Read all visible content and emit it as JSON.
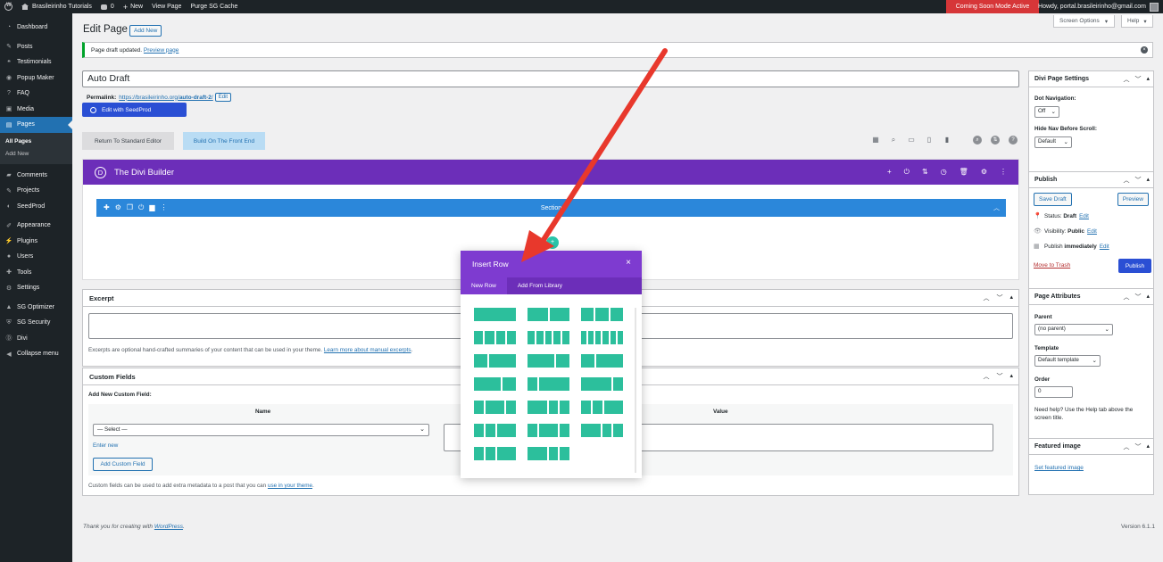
{
  "adminbar": {
    "site_name": "Brasileirinho Tutorials",
    "comments_count": "0",
    "new_label": "New",
    "view_page": "View Page",
    "purge": "Purge SG Cache",
    "coming_soon": "Coming Soon Mode Active",
    "howdy": "Howdy, portal.brasileirinho@gmail.com"
  },
  "sidebar": {
    "items": [
      {
        "label": "Dashboard",
        "icon": "dashboard-icon"
      },
      {
        "label": "Posts",
        "icon": "pin-icon"
      },
      {
        "label": "Testimonials",
        "icon": "testimonial-icon"
      },
      {
        "label": "Popup Maker",
        "icon": "popup-icon"
      },
      {
        "label": "FAQ",
        "icon": "question-icon"
      },
      {
        "label": "Media",
        "icon": "media-icon"
      },
      {
        "label": "Pages",
        "icon": "page-icon"
      },
      {
        "label": "Comments",
        "icon": "comment-icon"
      },
      {
        "label": "Projects",
        "icon": "project-icon"
      },
      {
        "label": "SeedProd",
        "icon": "seedprod-icon"
      },
      {
        "label": "Appearance",
        "icon": "brush-icon"
      },
      {
        "label": "Plugins",
        "icon": "plugin-icon"
      },
      {
        "label": "Users",
        "icon": "user-icon"
      },
      {
        "label": "Tools",
        "icon": "wrench-icon"
      },
      {
        "label": "Settings",
        "icon": "gear-icon"
      },
      {
        "label": "SG Optimizer",
        "icon": "optimizer-icon"
      },
      {
        "label": "SG Security",
        "icon": "shield-icon"
      },
      {
        "label": "Divi",
        "icon": "divi-icon"
      },
      {
        "label": "Collapse menu",
        "icon": "collapse-icon"
      }
    ],
    "submenu": [
      "All Pages",
      "Add New"
    ]
  },
  "header": {
    "title": "Edit Page",
    "add_new": "Add New",
    "screen_options": "Screen Options",
    "help": "Help"
  },
  "notice": {
    "text": "Page draft updated.",
    "link": "Preview page"
  },
  "editor": {
    "post_title": "Auto Draft",
    "permalink_label": "Permalink:",
    "permalink_base": "https://brasileirinho.org/",
    "permalink_slug": "auto-draft-2",
    "permalink_end": "/",
    "edit_btn": "Edit",
    "seedprod_btn": "Edit with SeedProd",
    "return_btn": "Return To Standard Editor",
    "front_end_btn": "Build On The Front End"
  },
  "divi": {
    "logo": "D",
    "title": "The Divi Builder",
    "section_label": "Section"
  },
  "insert_row": {
    "title": "Insert Row",
    "tabs": [
      "New Row",
      "Add From Library"
    ],
    "layouts": [
      [
        [
          1
        ],
        [
          1,
          1
        ],
        [
          1,
          1,
          1
        ]
      ],
      [
        [
          1,
          1,
          1,
          1
        ],
        [
          1,
          1,
          1,
          1,
          1
        ],
        [
          1,
          1,
          1,
          1,
          1,
          1
        ]
      ],
      [
        [
          1,
          2
        ],
        [
          2,
          1
        ],
        [
          1,
          2
        ]
      ],
      [
        [
          2,
          1
        ],
        [
          1,
          3
        ],
        [
          3,
          1
        ]
      ],
      [
        [
          1,
          2,
          1
        ],
        [
          2,
          1,
          1
        ],
        [
          1,
          1,
          2
        ]
      ],
      [
        [
          1,
          1,
          2
        ],
        [
          1,
          2,
          1
        ],
        [
          2,
          1,
          1
        ]
      ],
      [
        [
          1,
          1,
          2
        ],
        [
          2,
          1,
          1
        ]
      ]
    ]
  },
  "excerpt": {
    "title": "Excerpt",
    "help": "Excerpts are optional hand-crafted summaries of your content that can be used in your theme.",
    "help_link": "Learn more about manual excerpts"
  },
  "custom_fields": {
    "title": "Custom Fields",
    "add_label": "Add New Custom Field:",
    "col_name": "Name",
    "col_value": "Value",
    "select_placeholder": "— Select —",
    "enter_new": "Enter new",
    "add_btn": "Add Custom Field",
    "help": "Custom fields can be used to add extra metadata to a post that you can",
    "help_link": "use in your theme"
  },
  "divi_settings": {
    "title": "Divi Page Settings",
    "dot_nav_label": "Dot Navigation:",
    "dot_nav_value": "Off",
    "hide_nav_label": "Hide Nav Before Scroll:",
    "hide_nav_value": "Default"
  },
  "publish": {
    "title": "Publish",
    "save_draft": "Save Draft",
    "preview": "Preview",
    "status_label": "Status:",
    "status_value": "Draft",
    "visibility_label": "Visibility:",
    "visibility_value": "Public",
    "publish_label": "Publish",
    "publish_value": "immediately",
    "edit": "Edit",
    "trash": "Move to Trash",
    "publish_btn": "Publish"
  },
  "page_attributes": {
    "title": "Page Attributes",
    "parent_label": "Parent",
    "parent_value": "(no parent)",
    "template_label": "Template",
    "template_value": "Default template",
    "order_label": "Order",
    "order_value": "0",
    "help": "Need help? Use the Help tab above the screen title."
  },
  "featured_image": {
    "title": "Featured image",
    "link": "Set featured image"
  },
  "footer": {
    "thanks": "Thank you for creating with",
    "wp_link": "WordPress",
    "version": "Version 6.1.1"
  },
  "colors": {
    "divi_purple": "#6c2eb9",
    "section_blue": "#2b87da",
    "layout_teal": "#2cbf9c",
    "arrow_red": "#e8382c",
    "wp_blue": "#2271b1"
  }
}
